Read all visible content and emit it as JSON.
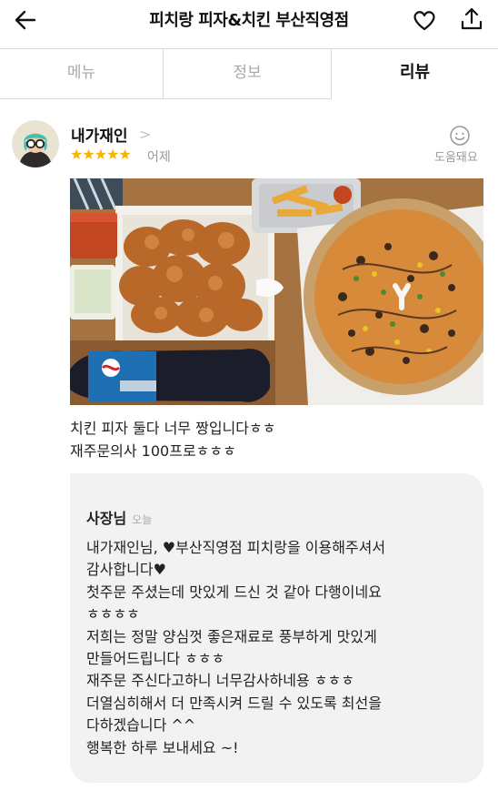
{
  "header": {
    "title": "피치랑 피자&치킨 부산직영점",
    "back_icon": "arrow-left-icon",
    "favorite_icon": "heart-outline-icon",
    "share_icon": "share-icon"
  },
  "tabs": [
    {
      "label": "메뉴"
    },
    {
      "label": "정보"
    },
    {
      "label": "리뷰"
    }
  ],
  "review": {
    "nickname": "내가재인",
    "chevron": ">",
    "stars": "★★★★★",
    "rating": 5,
    "date": "어제",
    "helpful_label": "도움돼요",
    "text_line1": "치킨 피자 둘다 너무 짱입니다ㅎㅎ",
    "text_line2": "재주문의사 100프로ㅎㅎㅎ"
  },
  "reply": {
    "owner": "사장님",
    "date": "오늘",
    "text": "내가재인님, ♥부산직영점 피치랑을 이용해주셔서\n감사합니다♥\n첫주문 주셨는데 맛있게 드신 것 같아 다행이네요\nㅎㅎㅎㅎ\n저희는 정말 양심껏 좋은재료로 풍부하게 맛있게\n만들어드립니다 ㅎㅎㅎ\n재주문 주신다고하니 너무감사하네용 ㅎㅎㅎ\n더열심히해서 더 만족시켜 드릴 수 있도록 최선을\n다하겠습니다 ^^\n행복한 하루 보내세요 ~!"
  },
  "colors": {
    "star": "#f5b400",
    "reply_bg": "#f2f2f2",
    "muted": "#999999"
  }
}
